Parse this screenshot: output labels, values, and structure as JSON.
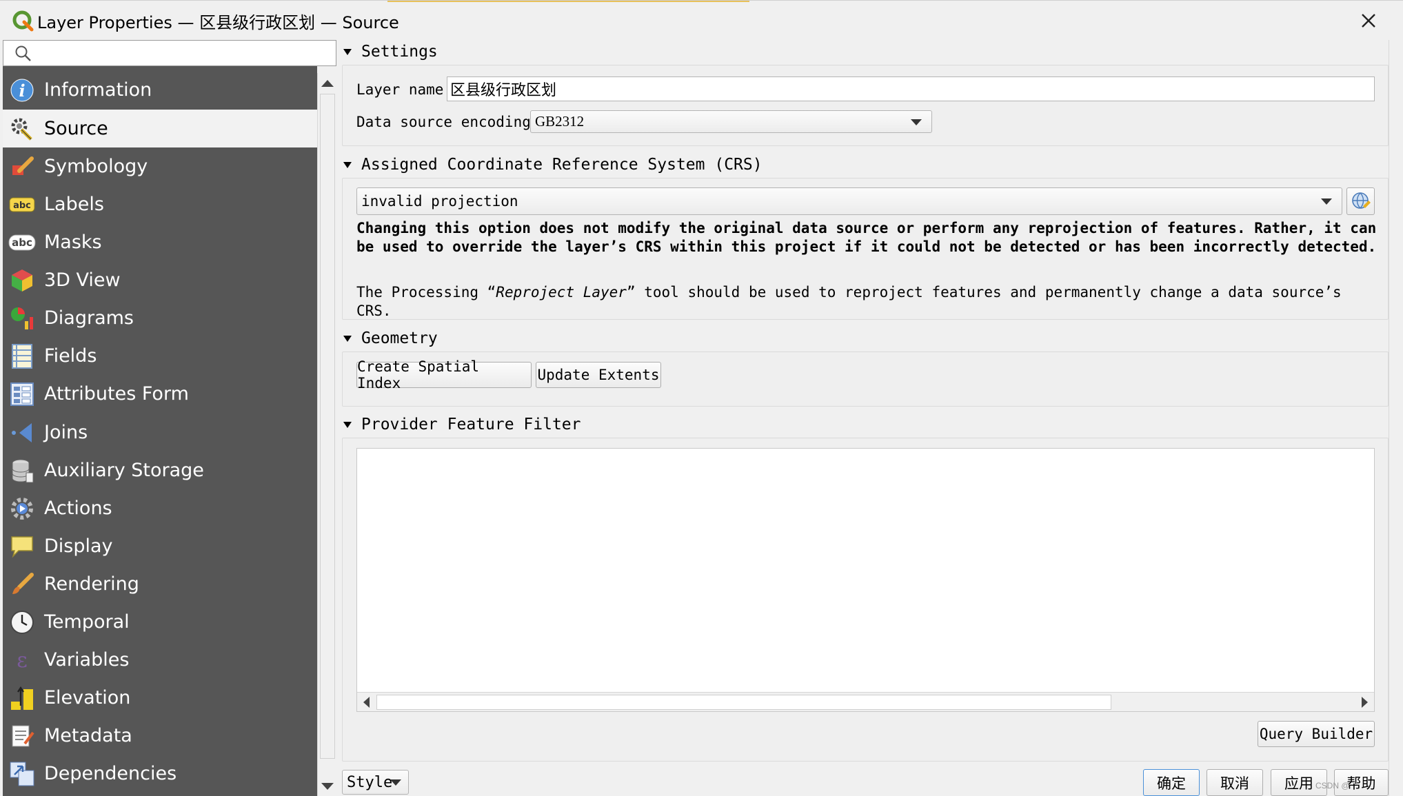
{
  "window": {
    "title": "Layer Properties — 区县级行政区划 — Source",
    "accent_color": "#e8c15a"
  },
  "search": {
    "placeholder": ""
  },
  "sidebar": {
    "background": "#565656",
    "items": [
      {
        "label": "Information",
        "icon": "info-icon"
      },
      {
        "label": "Source",
        "icon": "source-settings-icon",
        "active": true
      },
      {
        "label": "Symbology",
        "icon": "symbology-brush-icon"
      },
      {
        "label": "Labels",
        "icon": "labels-abc-icon"
      },
      {
        "label": "Masks",
        "icon": "masks-abc-icon"
      },
      {
        "label": "3D View",
        "icon": "3d-cube-icon"
      },
      {
        "label": "Diagrams",
        "icon": "diagrams-icon"
      },
      {
        "label": "Fields",
        "icon": "fields-icon"
      },
      {
        "label": "Attributes Form",
        "icon": "attributes-form-icon"
      },
      {
        "label": "Joins",
        "icon": "joins-icon"
      },
      {
        "label": "Auxiliary Storage",
        "icon": "database-icon"
      },
      {
        "label": "Actions",
        "icon": "actions-gear-icon"
      },
      {
        "label": "Display",
        "icon": "display-speech-bubble-icon"
      },
      {
        "label": "Rendering",
        "icon": "rendering-brush-icon"
      },
      {
        "label": "Temporal",
        "icon": "clock-icon"
      },
      {
        "label": "Variables",
        "icon": "variables-epsilon-icon"
      },
      {
        "label": "Elevation",
        "icon": "elevation-icon"
      },
      {
        "label": "Metadata",
        "icon": "metadata-icon"
      },
      {
        "label": "Dependencies",
        "icon": "dependencies-icon"
      }
    ]
  },
  "settings": {
    "header": "Settings",
    "layer_name_label": "Layer name",
    "layer_name_value": "区县级行政区划",
    "encoding_label": "Data source encoding",
    "encoding_value": "GB2312"
  },
  "crs": {
    "header": "Assigned Coordinate Reference System (CRS)",
    "value": "invalid projection",
    "warning": "Changing this option does not modify the original data source or perform any reprojection of features. Rather, it can be used to override the layer’s CRS within this project if it could not be detected or has been incorrectly detected.",
    "processing_prefix": "The Processing “",
    "processing_tool": "Reproject Layer",
    "processing_suffix": "” tool should be used to reproject features and permanently change a data source’s CRS."
  },
  "geometry": {
    "header": "Geometry",
    "create_index": "Create Spatial Index",
    "update_extents": "Update Extents"
  },
  "filter": {
    "header": "Provider Feature Filter",
    "text": "",
    "query_builder": "Query Builder"
  },
  "footer": {
    "style": "Style",
    "ok": "确定",
    "cancel": "取消",
    "apply": "应用",
    "help": "帮助",
    "watermark": "CSDN @"
  }
}
